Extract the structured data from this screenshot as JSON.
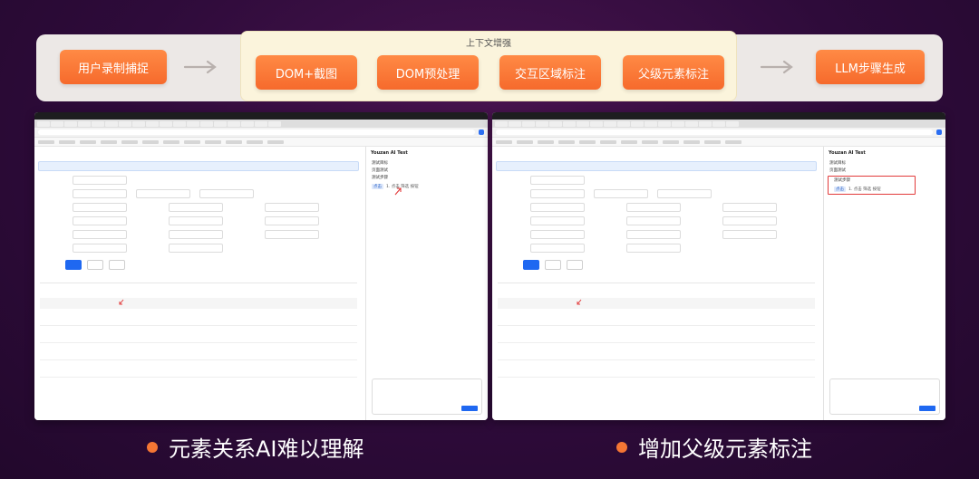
{
  "pipeline": {
    "input_label": "用户录制捕捉",
    "context_title": "上下文增强",
    "steps": [
      "DOM+截图",
      "DOM预处理",
      "交互区域标注",
      "父级元素标注"
    ],
    "output_label": "LLM步骤生成"
  },
  "panel": {
    "title": "Youzan AI Test",
    "goal_label": "测试目标",
    "goal_value": "页面测试",
    "steps_label": "测试步骤",
    "step_tag": "点击",
    "step_text": "1. 点击 筛选 按钮"
  },
  "captions": {
    "left": "元素关系AI难以理解",
    "right": "增加父级元素标注"
  },
  "colors": {
    "accent": "#f66a2c",
    "highlight": "#e23b3b"
  }
}
